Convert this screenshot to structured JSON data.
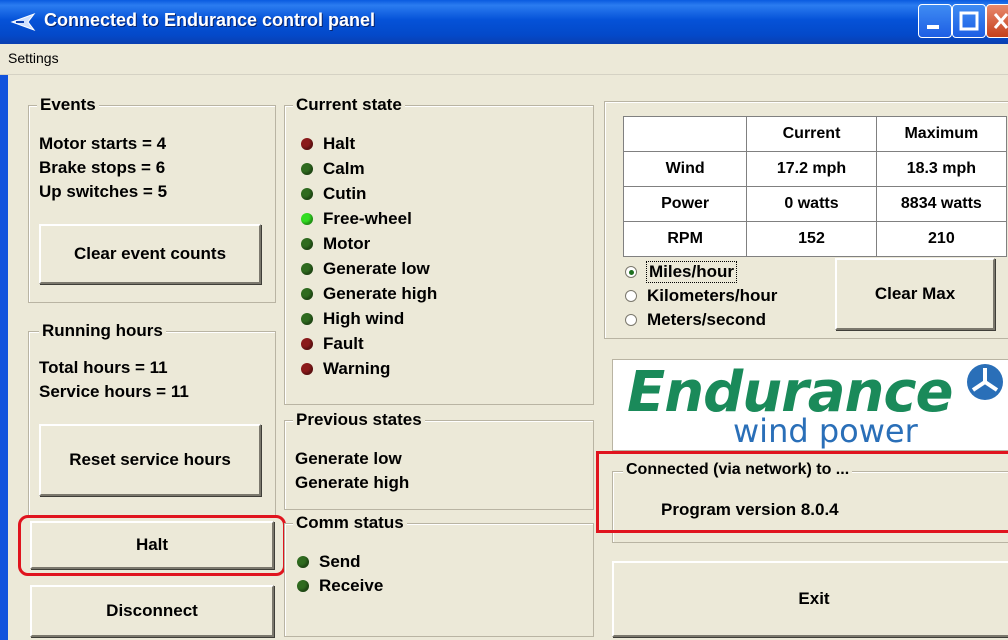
{
  "window": {
    "title": "Connected to Endurance control panel"
  },
  "menu": {
    "settings": "Settings"
  },
  "events": {
    "legend": "Events",
    "motor_starts": "Motor starts = 4",
    "brake_stops": "Brake stops = 6",
    "up_switches": "Up switches = 5",
    "clear_button": "Clear event counts"
  },
  "running_hours": {
    "legend": "Running hours",
    "total": "Total hours = 11",
    "service": "Service hours = 11",
    "reset_button": "Reset service hours"
  },
  "buttons": {
    "halt": "Halt",
    "disconnect": "Disconnect",
    "clear_max": "Clear Max",
    "exit": "Exit"
  },
  "current_state": {
    "legend": "Current state",
    "items": [
      {
        "label": "Halt",
        "color": "#8b1a1a"
      },
      {
        "label": "Calm",
        "color": "#2f6b1f"
      },
      {
        "label": "Cutin",
        "color": "#2f6b1f"
      },
      {
        "label": "Free-wheel",
        "color": "#33dd22"
      },
      {
        "label": "Motor",
        "color": "#2f6b1f"
      },
      {
        "label": "Generate low",
        "color": "#2f6b1f"
      },
      {
        "label": "Generate high",
        "color": "#2f6b1f"
      },
      {
        "label": "High wind",
        "color": "#2f6b1f"
      },
      {
        "label": "Fault",
        "color": "#8b1a1a"
      },
      {
        "label": "Warning",
        "color": "#8b1a1a"
      }
    ]
  },
  "previous_states": {
    "legend": "Previous states",
    "line1": "Generate low",
    "line2": "Generate high"
  },
  "comm_status": {
    "legend": "Comm status",
    "send": "Send",
    "receive": "Receive",
    "send_color": "#2f6b1f",
    "receive_color": "#2f6b1f"
  },
  "readings": {
    "headers": [
      "",
      "Current",
      "Maximum"
    ],
    "rows": [
      [
        "Wind",
        "17.2 mph",
        "18.3 mph"
      ],
      [
        "Power",
        "0 watts",
        "8834 watts"
      ],
      [
        "RPM",
        "152",
        "210"
      ]
    ]
  },
  "units": {
    "options": [
      "Miles/hour",
      "Kilometers/hour",
      "Meters/second"
    ],
    "selected": "Miles/hour"
  },
  "logo": {
    "brand": "Endurance",
    "tagline": "wind power",
    "brand_color": "#1a8a5a",
    "tagline_color": "#2a6fb8"
  },
  "connection": {
    "legend": "Connected (via network) to ...",
    "version": "Program version 8.0.4"
  },
  "colors": {
    "highlight": "#e0141e",
    "title_bar": "#0552d8"
  }
}
